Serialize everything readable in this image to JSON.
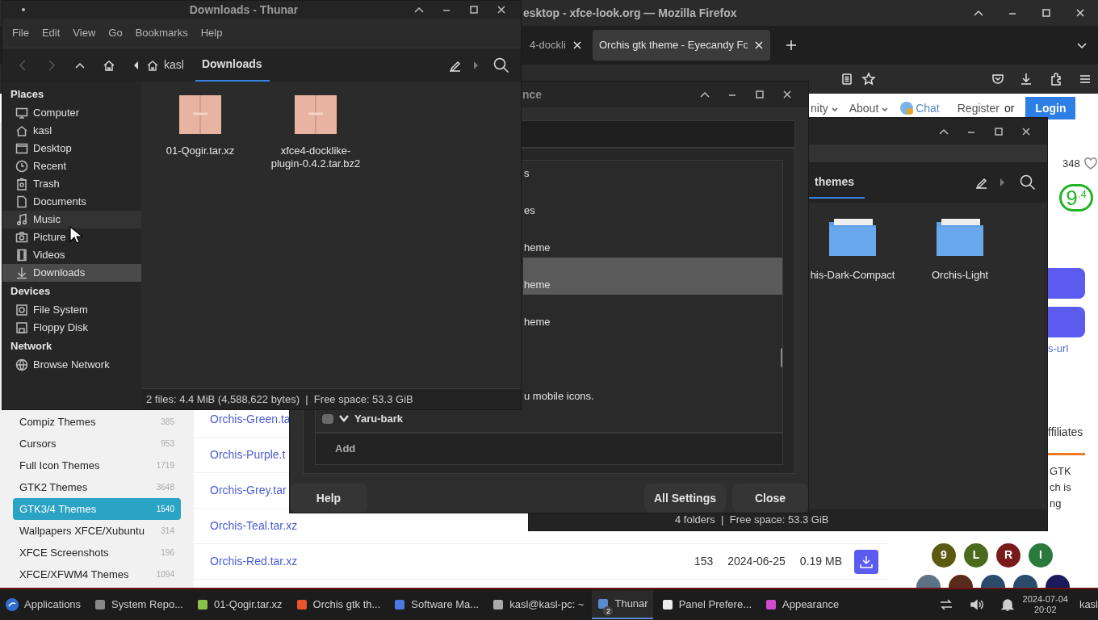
{
  "firefox": {
    "title": "esktop - xfce-look.org — Mozilla Firefox",
    "tabs": [
      {
        "label": "4-dockli",
        "selected": false
      },
      {
        "label": "Orchis gtk theme - Eyecandy Fo",
        "selected": true
      }
    ],
    "nav": [
      {
        "label": "nity",
        "kind": "menu"
      },
      {
        "label": "About",
        "kind": "menu"
      },
      {
        "label": "Chat",
        "kind": "chat"
      },
      {
        "label": "Register",
        "kind": "link"
      },
      {
        "label": "or",
        "kind": "text"
      }
    ],
    "login": "Login",
    "likes": "348",
    "score": "9",
    "score_decimal": ".4",
    "side_link": "s-url",
    "affiliates": "ffiliates",
    "blurb": [
      "GTK",
      "ch is",
      "ng"
    ],
    "categories": [
      {
        "label": "Compiz Themes",
        "count": "385",
        "selected": false
      },
      {
        "label": "Cursors",
        "count": "953",
        "selected": false
      },
      {
        "label": "Full Icon Themes",
        "count": "1719",
        "selected": false
      },
      {
        "label": "GTK2 Themes",
        "count": "3648",
        "selected": false
      },
      {
        "label": "GTK3/4 Themes",
        "count": "1540",
        "selected": true
      },
      {
        "label": "Wallpapers XFCE/Xubuntu",
        "count": "314",
        "selected": false
      },
      {
        "label": "XFCE Screenshots",
        "count": "196",
        "selected": false
      },
      {
        "label": "XFCE/XFWM4 Themes",
        "count": "1094",
        "selected": false
      }
    ],
    "files": [
      {
        "name": "Orchis-Green.ta"
      },
      {
        "name": "Orchis-Purple.t"
      },
      {
        "name": "Orchis-Grey.tar"
      },
      {
        "name": "Orchis-Teal.tar.xz"
      },
      {
        "name": "Orchis-Red.tar.xz",
        "downloads": "153",
        "date": "2024-06-25",
        "size": "0.19 MB",
        "download_button": true
      }
    ],
    "avatars": [
      {
        "letter": "9",
        "color": "#5c5a12"
      },
      {
        "letter": "L",
        "color": "#4b6b1c"
      },
      {
        "letter": "R",
        "color": "#7a1b1b"
      },
      {
        "letter": "I",
        "color": "#2a7a3c"
      }
    ],
    "avatars_row2": [
      {
        "color": "#5d7283"
      },
      {
        "color": "#5a2a1a"
      },
      {
        "color": "#2a4c6c"
      },
      {
        "color": "#2a4c6c"
      },
      {
        "color": "#1b1b5c"
      }
    ]
  },
  "appearance": {
    "title": "nce",
    "rows": [
      {
        "text": "s",
        "kind": "cut",
        "selected": false
      },
      {
        "text": "es",
        "kind": "cut",
        "selected": false
      },
      {
        "text": "heme",
        "kind": "cut",
        "selected": false
      },
      {
        "text": "heme",
        "kind": "cut",
        "selected": true
      },
      {
        "text": "heme",
        "kind": "cut",
        "selected": false
      },
      {
        "text": "u mobile icons.",
        "kind": "cut_tall",
        "selected": false
      },
      {
        "text": "Yaru-bark",
        "kind": "theme",
        "checked": false,
        "selected": false
      }
    ],
    "add": "Add",
    "help": "Help",
    "all_settings": "All Settings",
    "close": "Close"
  },
  "thunar_themes": {
    "path": "themes",
    "folders": [
      "his-Dark-Compact",
      "Orchis-Light"
    ],
    "status": "4 folders  |  Free space: 53.3 GiB"
  },
  "thunar": {
    "title": "Downloads - Thunar",
    "menu": [
      "File",
      "Edit",
      "View",
      "Go",
      "Bookmarks",
      "Help"
    ],
    "path": [
      {
        "label": "kasl",
        "selected": false
      },
      {
        "label": "Downloads",
        "selected": true
      }
    ],
    "sidebar": [
      {
        "heading": "Places",
        "items": [
          {
            "label": "Computer",
            "selected": false,
            "hovered": false
          },
          {
            "label": "kasl",
            "selected": false,
            "hovered": false
          },
          {
            "label": "Desktop",
            "selected": false,
            "hovered": false
          },
          {
            "label": "Recent",
            "selected": false,
            "hovered": false
          },
          {
            "label": "Trash",
            "selected": false,
            "hovered": false
          },
          {
            "label": "Documents",
            "selected": false,
            "hovered": false
          },
          {
            "label": "Music",
            "selected": false,
            "hovered": true
          },
          {
            "label": "Picture",
            "selected": false,
            "hovered": false
          },
          {
            "label": "Videos",
            "selected": false,
            "hovered": false
          },
          {
            "label": "Downloads",
            "selected": true,
            "hovered": false
          }
        ]
      },
      {
        "heading": "Devices",
        "items": [
          {
            "label": "File System",
            "selected": false,
            "hovered": false
          },
          {
            "label": "Floppy Disk",
            "selected": false,
            "hovered": false
          }
        ]
      },
      {
        "heading": "Network",
        "items": [
          {
            "label": "Browse Network",
            "selected": false,
            "hovered": false
          }
        ]
      }
    ],
    "files": [
      "01-Qogir.tar.xz",
      "xfce4-docklike-plugin-0.4.2.tar.bz2"
    ],
    "status": "2 files: 4.4 MiB (4,588,622 bytes)  |  Free space: 53.3 GiB"
  },
  "taskbar": {
    "applications": "Applications",
    "tasks": [
      {
        "label": "System Repo...",
        "selected": false
      },
      {
        "label": "01-Qogir.tar.xz",
        "selected": false
      },
      {
        "label": "Orchis gtk th...",
        "selected": false
      },
      {
        "label": "Software Ma...",
        "selected": false
      },
      {
        "label": "kasl@kasl-pc: ~",
        "selected": false
      },
      {
        "label": "Thunar",
        "selected": true,
        "badge": "2"
      },
      {
        "label": "Panel Prefere...",
        "selected": false
      },
      {
        "label": "Appearance",
        "selected": false
      }
    ],
    "date": "2024-07-04",
    "time": "20:02",
    "user": "kasl"
  }
}
